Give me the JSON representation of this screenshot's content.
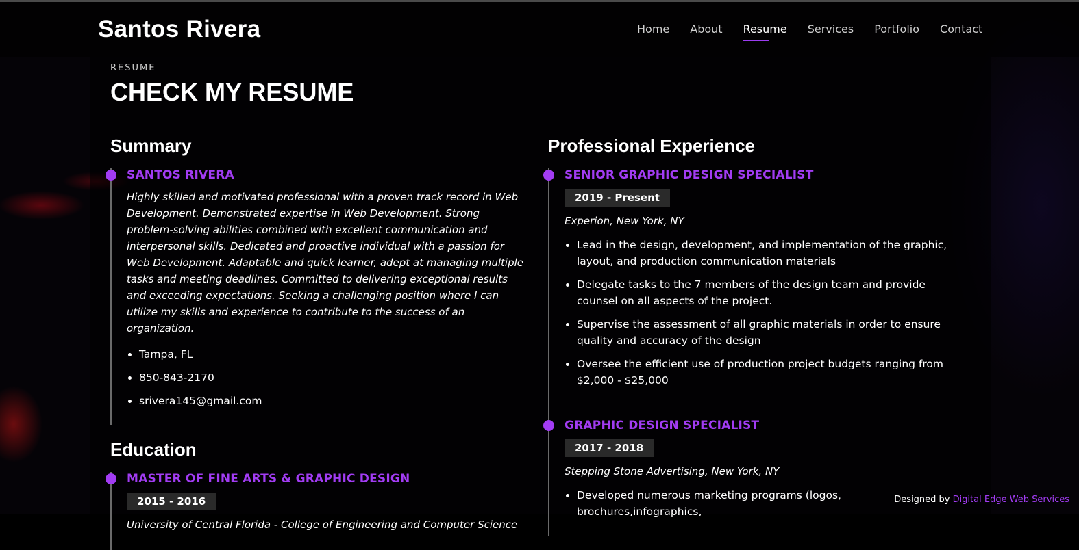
{
  "brand": "Santos Rivera",
  "nav": [
    "Home",
    "About",
    "Resume",
    "Services",
    "Portfolio",
    "Contact"
  ],
  "section": {
    "label": "RESUME",
    "title": "CHECK MY RESUME"
  },
  "summary": {
    "heading": "Summary",
    "name": "SANTOS RIVERA",
    "text": "Highly skilled and motivated professional with a proven track record in Web Development. Demonstrated expertise in Web Development. Strong problem-solving abilities combined with excellent communication and interpersonal skills. Dedicated and proactive individual with a passion for Web Development. Adaptable and quick learner, adept at managing multiple tasks and meeting deadlines. Committed to delivering exceptional results and exceeding expectations. Seeking a challenging position where I can utilize my skills and experience to contribute to the success of an organization.",
    "contacts": [
      "Tampa, FL",
      "850-843-2170",
      "srivera145@gmail.com"
    ]
  },
  "education": {
    "heading": "Education",
    "items": [
      {
        "title": "MASTER OF FINE ARTS & GRAPHIC DESIGN",
        "years": "2015 - 2016",
        "school": "University of Central Florida - College of Engineering and Computer Science"
      }
    ]
  },
  "experience": {
    "heading": "Professional Experience",
    "jobs": [
      {
        "title": "SENIOR GRAPHIC DESIGN SPECIALIST",
        "years": "2019 - Present",
        "company": "Experion, New York, NY",
        "duties": [
          "Lead in the design, development, and implementation of the graphic, layout, and production communication materials",
          "Delegate tasks to the 7 members of the design team and provide counsel on all aspects of the project.",
          "Supervise the assessment of all graphic materials in order to ensure quality and accuracy of the design",
          "Oversee the efficient use of production project budgets ranging from $2,000 - $25,000"
        ]
      },
      {
        "title": "GRAPHIC DESIGN SPECIALIST",
        "years": "2017 - 2018",
        "company": "Stepping Stone Advertising, New York, NY",
        "duties": [
          "Developed numerous marketing programs (logos, brochures,infographics,"
        ]
      }
    ]
  },
  "footer": {
    "prefix": "Designed by",
    "link": "Digital Edge Web Services"
  },
  "colors": {
    "accent": "#a23cf3",
    "background": "#000000",
    "date_badge": "#2a2a2a"
  }
}
